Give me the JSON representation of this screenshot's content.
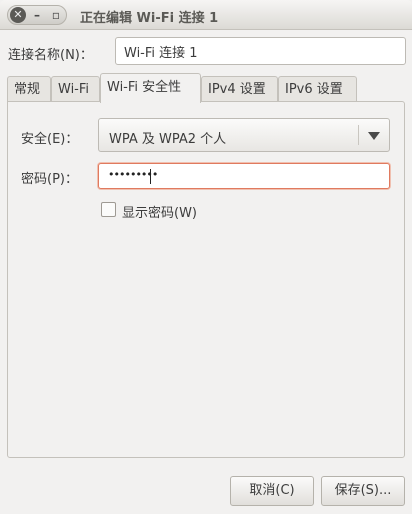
{
  "window": {
    "title": "正在编辑 Wi-Fi 连接 1"
  },
  "connection": {
    "name_label": "连接名称(N)：",
    "name_value": "Wi-Fi 连接 1"
  },
  "tabs": [
    {
      "label": "常规"
    },
    {
      "label": "Wi-Fi"
    },
    {
      "label": "Wi-Fi 安全性",
      "active": true
    },
    {
      "label": "IPv4 设置"
    },
    {
      "label": "IPv6 设置"
    }
  ],
  "security": {
    "label": "安全(E)：",
    "selected": "WPA 及 WPA2 个人"
  },
  "password": {
    "label": "密码(P)：",
    "masked_value": "•••••••••"
  },
  "show_password": {
    "label": "显示密码(W)",
    "checked": false
  },
  "buttons": {
    "cancel": "取消(C)",
    "save": "保存(S)..."
  }
}
